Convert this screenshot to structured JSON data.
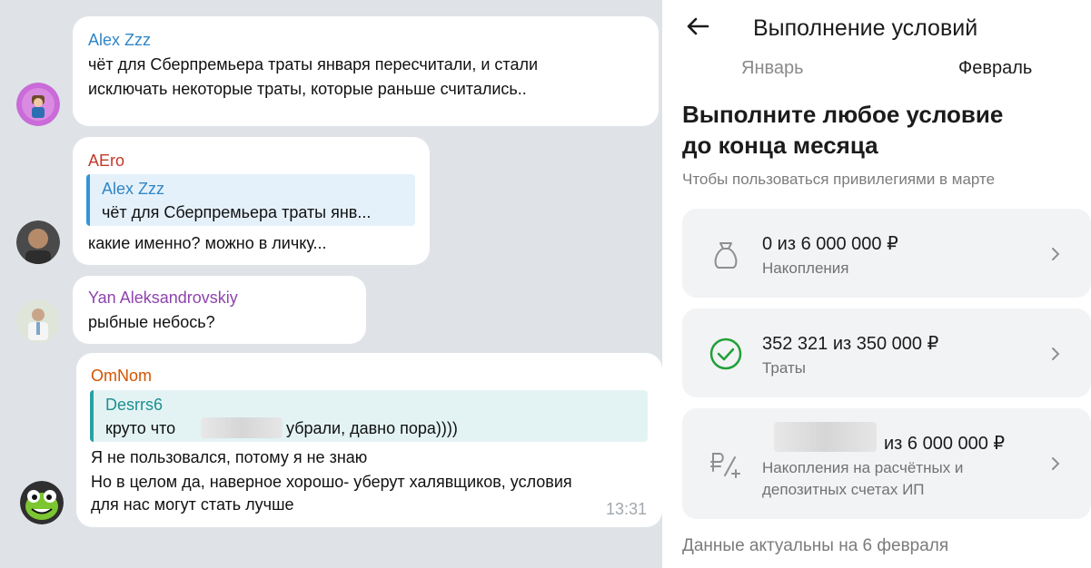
{
  "chat": {
    "messages": [
      {
        "sender": "Alex Zzz",
        "sender_color": "#2f86c9",
        "lines": [
          "чёт для Сберпремьера траты января пересчитали, и стали",
          "исключать некоторые траты, которые раньше считались.."
        ]
      },
      {
        "sender": "AEro",
        "sender_color": "#c0392b",
        "quote": {
          "author": "Alex Zzz",
          "text": "чёт для Сберпремьера траты янв..."
        },
        "lines": [
          "какие именно? можно в личку..."
        ]
      },
      {
        "sender": "Yan Aleksandrovskiy",
        "sender_color": "#8e44ad",
        "lines": [
          "рыбные небось?"
        ]
      },
      {
        "sender": "OmNom",
        "sender_color": "#d35400",
        "quote": {
          "author": "Desrrs6",
          "text_before": "круто что",
          "text_after": "убрали, давно пора))))"
        },
        "lines": [
          "Я не пользовался, потому я не знаю",
          "Но в целом да, наверное хорошо- уберут халявщиков, условия",
          "для нас могут стать лучше"
        ],
        "time": "13:31"
      }
    ]
  },
  "bank": {
    "title": "Выполнение условий",
    "tabs": [
      "Январь",
      "Февраль"
    ],
    "active_tab": "Февраль",
    "headline": [
      "Выполните любое условие",
      "до конца месяца"
    ],
    "subtitle": "Чтобы пользоваться привилегиями в марте",
    "cards": [
      {
        "icon": "money-bag-icon",
        "value": "0 из 6 000 000 ₽",
        "label": "Накопления"
      },
      {
        "icon": "check-circle-icon",
        "value": "352 321 из 350 000 ₽",
        "label": "Траты"
      },
      {
        "icon": "ruble-percent-icon",
        "value": "из 6 000 000 ₽",
        "label_lines": [
          "Накопления на расчётных и",
          "депозитных счетах ИП"
        ]
      }
    ],
    "footer": "Данные актуальны на 6 февраля",
    "colors": {
      "accent_green": "#21a038",
      "card_bg": "#f2f3f5",
      "chat_bg": "#dfe3e8"
    }
  }
}
